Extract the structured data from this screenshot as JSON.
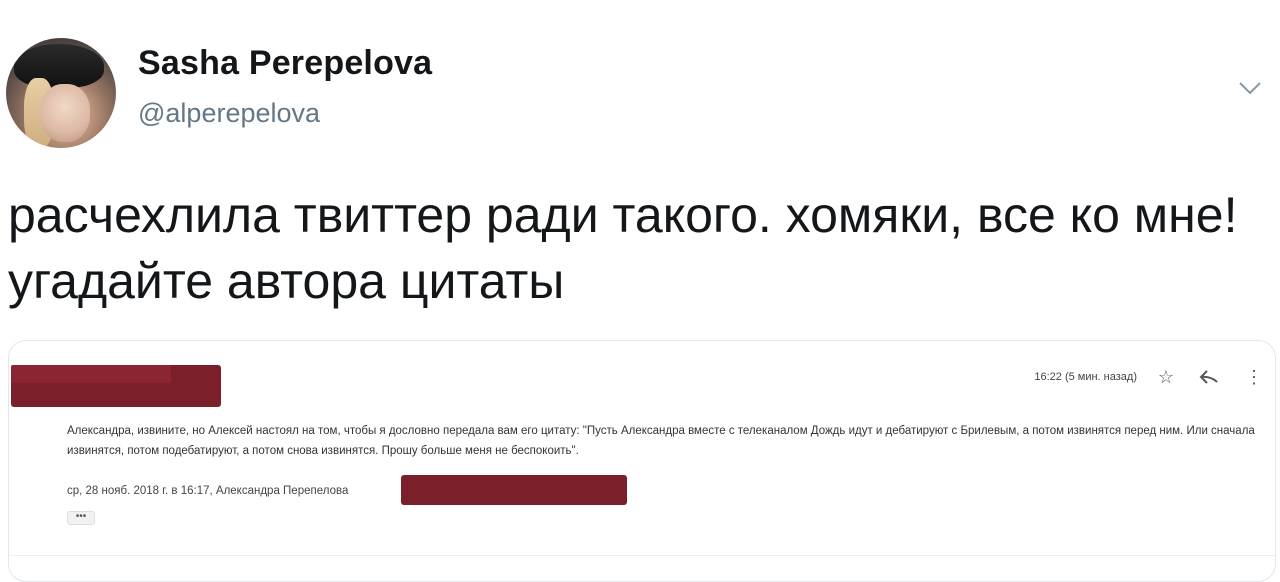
{
  "author": {
    "name": "Sasha Perepelova",
    "handle": "@alperepelova"
  },
  "tweet": {
    "text": "расчехлила твиттер ради такого. хомяки, все ко мне! угадайте автора цитаты"
  },
  "email": {
    "time": "16:22 (5 мин. назад)",
    "body": "Александра, извините, но Алексей настоял на том, чтобы я дословно передала вам его цитату: \"Пусть Александра вместе с телеканалом Дождь идут и дебатируют с Брилевым, а потом извинятся перед ним. Или сначала извинятся, потом подебатируют, а потом снова извинятся. Прошу больше меня не беспокоить\".",
    "quote_header": "ср, 28 нояб. 2018 г. в 16:17, Александра Перепелова",
    "more_label": "•••"
  },
  "colors": {
    "redaction": "#7b1f2a",
    "handle": "#657786"
  },
  "icons": {
    "menu": "chevron-down-icon",
    "star": "star-icon",
    "reply": "reply-icon",
    "more": "more-vertical-icon"
  }
}
